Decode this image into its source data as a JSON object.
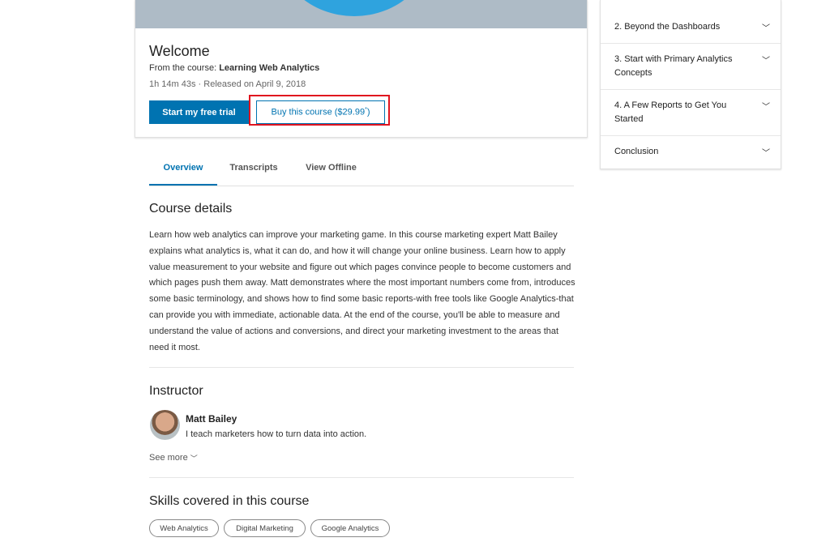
{
  "hero": {
    "title": "Welcome",
    "course_prefix": "From the course: ",
    "course_name": "Learning Web Analytics",
    "duration": "1h 14m 43s",
    "released": "Released on April 9, 2018",
    "meta_separator": "·",
    "trial_button": "Start my free trial",
    "buy_button": "Buy this course ($29.99",
    "buy_button_mark": "*",
    "buy_button_close": ")"
  },
  "tabs": [
    {
      "label": "Overview",
      "active": true
    },
    {
      "label": "Transcripts",
      "active": false
    },
    {
      "label": "View Offline",
      "active": false
    }
  ],
  "course_details": {
    "heading": "Course details",
    "body": "Learn how web analytics can improve your marketing game. In this course marketing expert Matt Bailey explains what analytics is, what it can do, and how it will change your online business. Learn how to apply value measurement to your website and figure out which pages convince people to become customers and which pages push them away. Matt demonstrates where the most important numbers come from, introduces some basic terminology, and shows how to find some basic reports-with free tools like Google Analytics-that can provide you with immediate, actionable data. At the end of the course, you'll be able to measure and understand the value of actions and conversions, and direct your marketing investment to the areas that need it most."
  },
  "instructor": {
    "heading": "Instructor",
    "name": "Matt Bailey",
    "bio": "I teach marketers how to turn data into action.",
    "see_more": "See more"
  },
  "skills": {
    "heading": "Skills covered in this course",
    "items": [
      "Web Analytics",
      "Digital Marketing",
      "Google Analytics"
    ]
  },
  "toc": {
    "items": [
      {
        "label": "2. Beyond the Dashboards"
      },
      {
        "label": "3. Start with Primary Analytics Concepts"
      },
      {
        "label": "4. A Few Reports to Get You Started"
      },
      {
        "label": "Conclusion"
      }
    ]
  },
  "colors": {
    "accent": "#0073b1",
    "highlight": "#e0141f",
    "banner": "#aebbc6",
    "banner_circle": "#2fa3de"
  }
}
